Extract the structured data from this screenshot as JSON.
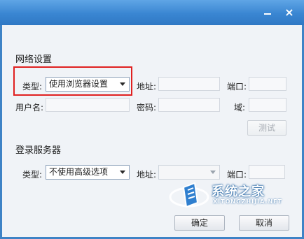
{
  "window": {
    "minimize_icon": "minimize-icon",
    "close_glyph": "×"
  },
  "network": {
    "section_title": "网络设置",
    "type_label": "类型:",
    "type_value": "使用浏览器设置",
    "address_label": "地址:",
    "port_label": "端口:",
    "username_label": "用户名:",
    "password_label": "密码:",
    "domain_label": "域:",
    "test_button": "测试"
  },
  "login_server": {
    "section_title": "登录服务器",
    "type_label": "类型:",
    "type_value": "不使用高级选项",
    "address_label": "地址:",
    "port_label": "端口:"
  },
  "footer": {
    "ok_button": "确定",
    "cancel_button": "取消"
  },
  "watermark": {
    "text": "系统之家",
    "subtext": "XITONGZHIJIA.NET"
  },
  "colors": {
    "titlebar": "#3a86d2",
    "panel": "#f0f3f7",
    "highlight": "#e02020"
  }
}
